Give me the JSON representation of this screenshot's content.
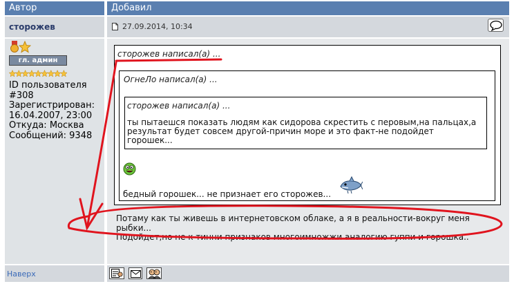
{
  "header": {
    "col_author": "Автор",
    "col_added": "Добавил"
  },
  "post": {
    "author": "сторожев",
    "date": "27.09.2014, 10:34",
    "rank_badge": "гл. админ",
    "info_lines": [
      "ID пользователя",
      "#308",
      "Зарегистрирован:",
      "16.04.2007, 23:00",
      "Откуда: Москва",
      "Сообщений: 9348"
    ],
    "outer_quote_header": "сторожев написал(а) ...",
    "middle_quote_header": "ОгнеЛо написал(а) ...",
    "inner_quote_header": "сторожев написал(а) ...",
    "inner_quote_lines": [
      "ты пытаешся показать людям как сидорова скрестить с перовым,на пальцах,а",
      "результат будет совсем другой-причин море и это факт-не подойдет",
      "горошек..."
    ],
    "middle_quote_text": "бедный горошек... не признает его сторожев...",
    "body_lines": [
      "Потаму как ты живешь в интернетовском облаке, а я в реальности-вокруг меня",
      "рыбки...",
      "Подойдет,но не к тинни признаков многоимножжи аналогию гуппи и горошка.."
    ]
  },
  "footer": {
    "top_link": "Наверх"
  },
  "colors": {
    "header_bg": "#5a7fb0",
    "annotation_red": "#e0141e",
    "link": "#3a6ab8"
  },
  "icons": [
    "post-document-icon",
    "quote-speech-bubble-icon",
    "profile-card-icon",
    "private-message-icon",
    "user-friends-icon",
    "medal-icon",
    "star-icon",
    "smiley-icon",
    "shark-smiley-icon"
  ]
}
